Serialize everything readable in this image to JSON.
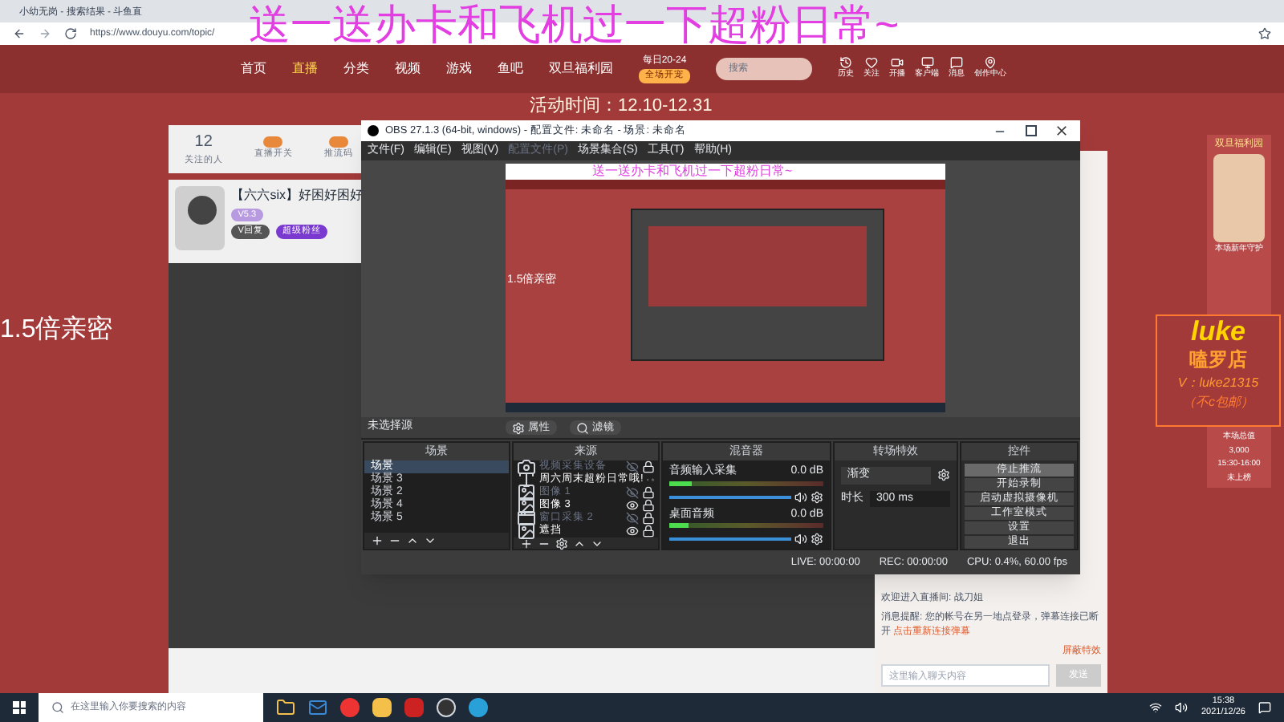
{
  "overlay_title": "送一送办卡和飞机过一下超粉日常~",
  "browser": {
    "tabs": [
      {
        "label": "小幼无岗 - 搜索结果 - 斗鱼直",
        "selected": false
      }
    ],
    "address": "https://www.douyu.com/topic/"
  },
  "site_nav": {
    "items": [
      {
        "label": "首页",
        "selected": false
      },
      {
        "label": "直播",
        "selected": true
      },
      {
        "label": "分类",
        "selected": false
      },
      {
        "label": "视频",
        "selected": false
      },
      {
        "label": "游戏",
        "selected": false
      },
      {
        "label": "鱼吧",
        "selected": false
      },
      {
        "label": "双旦福利园",
        "selected": false
      }
    ],
    "promo_time": "每日20-24",
    "promo_badge": "全场开宠",
    "search": {
      "placeholder": "搜索"
    },
    "actions": [
      "历史",
      "关注",
      "开播",
      "客户端",
      "消息",
      "创作中心"
    ]
  },
  "activity_time": "活动时间：12.10-12.31",
  "room_card": {
    "stats": [
      {
        "value": "12",
        "label": "关注的人"
      },
      {
        "label": "直播开关"
      },
      {
        "label": "推流码"
      }
    ],
    "title": "【六六six】好困好困好",
    "tag": "V5.3",
    "follow": "V回复",
    "fan": "超级粉丝"
  },
  "left_caption": "1.5倍亲密",
  "obs": {
    "title": "OBS 27.1.3 (64-bit, windows) - 配置文件: 未命名 - 场景: 未命名",
    "menu": [
      {
        "label": "文件(F)",
        "disabled": false
      },
      {
        "label": "编辑(E)",
        "disabled": false
      },
      {
        "label": "视图(V)",
        "disabled": false
      },
      {
        "label": "配置文件(P)",
        "disabled": true
      },
      {
        "label": "场景集合(S)",
        "disabled": false
      },
      {
        "label": "工具(T)",
        "disabled": false
      },
      {
        "label": "帮助(H)",
        "disabled": false
      }
    ],
    "preview": {
      "title": "送一送办卡和飞机过一下超粉日常~",
      "caption": "1.5倍亲密"
    },
    "source_bar": {
      "label": "未选择源",
      "buttons": [
        "属性",
        "滤镜"
      ]
    },
    "docks": [
      "场景",
      "来源",
      "混音器",
      "转场特效",
      "控件"
    ],
    "scenes": [
      {
        "label": "场景",
        "selected": true
      },
      {
        "label": "场景 3",
        "selected": false
      },
      {
        "label": "场景 2",
        "selected": false
      },
      {
        "label": "场景 4",
        "selected": false
      },
      {
        "label": "场景 5",
        "selected": false
      }
    ],
    "sources": [
      {
        "label": "视频采集设备",
        "kind": "camera",
        "visible": false
      },
      {
        "label": "周六周末超粉日常哦!",
        "kind": "text",
        "visible": true
      },
      {
        "label": "图像 1",
        "kind": "image",
        "visible": false
      },
      {
        "label": "图像 3",
        "kind": "image",
        "visible": true
      },
      {
        "label": "窗口采集 2",
        "kind": "window",
        "visible": false
      },
      {
        "label": "遮挡",
        "kind": "image",
        "visible": true
      }
    ],
    "mixer": [
      {
        "name": "音频输入采集",
        "reading": "0.0 dB",
        "meter": {
          "level": 0.15
        },
        "volume": {
          "level": 1
        }
      },
      {
        "name": "桌面音频",
        "reading": "0.0 dB",
        "meter": {
          "level": 0.12
        },
        "volume": {
          "level": 1
        }
      }
    ],
    "transition": {
      "value": "渐变",
      "duration_label": "时长",
      "duration": "300 ms"
    },
    "controls": [
      {
        "label": "停止推流",
        "selected": true
      },
      {
        "label": "开始录制",
        "selected": false
      },
      {
        "label": "启动虚拟摄像机",
        "selected": false
      },
      {
        "label": "工作室模式",
        "selected": false
      },
      {
        "label": "设置",
        "selected": false
      },
      {
        "label": "退出",
        "selected": false
      }
    ],
    "status": [
      "LIVE: 00:00:00",
      "REC: 00:00:00",
      "CPU: 0.4%, 60.00 fps"
    ]
  },
  "chat": {
    "lines": [
      "欢迎进入直播间: 战刀姐",
      "消息提醒: 您的帐号在另一地点登录，弹幕连接已断开"
    ],
    "reconnect": "点击重新连接弹幕",
    "block": "屏蔽特效",
    "input": {
      "placeholder": "这里输入聊天内容"
    },
    "send": "发送"
  },
  "side_widget": {
    "title": "双旦福利园",
    "guard": "本场新年守护",
    "total_label": "本场总值",
    "total": "3,000",
    "slot": "15:30-16:00",
    "rank": "未上榜"
  },
  "sign": {
    "name": "luke",
    "shop": "嗑罗店",
    "contact": "V：luke21315",
    "note": "（不c包邮）"
  },
  "taskbar": {
    "search": {
      "placeholder": "在这里输入你要搜索的内容"
    },
    "time": "15:38",
    "date": "2021/12/26"
  }
}
